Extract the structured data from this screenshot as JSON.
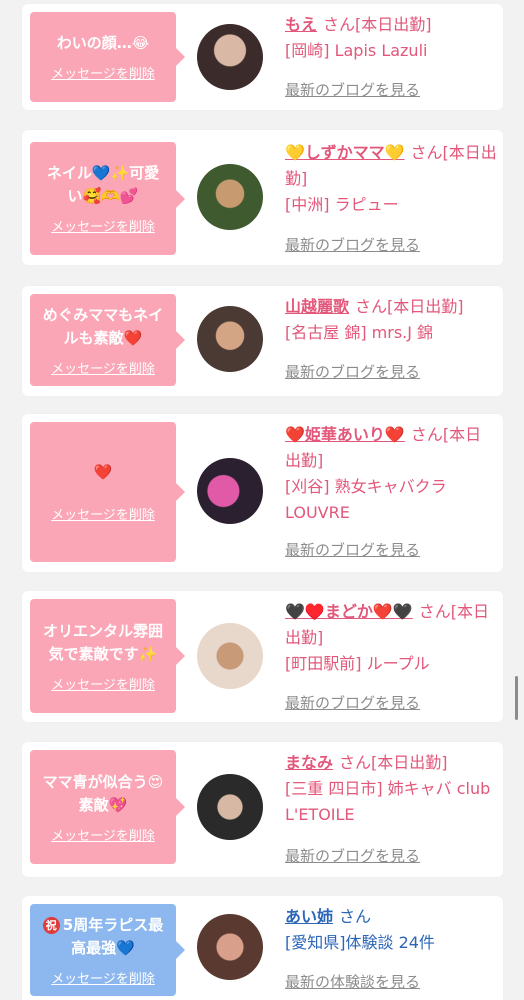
{
  "cards": [
    {
      "message": "わいの顔…😂",
      "delete_label": "メッセージを削除",
      "name": "もえ",
      "suffix": "さん[本日出勤]",
      "shop": "[岡崎] Lapis Lazuli",
      "link": "最新のブログを見る",
      "avatar_colors": [
        "#3b2b2a",
        "#d9b9a6"
      ]
    },
    {
      "message": "ネイル💙✨可愛い🥰🫶💕",
      "delete_label": "メッセージを削除",
      "name": "💛しずかママ💛",
      "suffix": "さん[本日出勤]",
      "shop": "[中洲] ラピュー",
      "link": "最新のブログを見る",
      "avatar_colors": [
        "#3f5a2e",
        "#c79a70"
      ]
    },
    {
      "message": "めぐみママもネイルも素敵❤️",
      "delete_label": "メッセージを削除",
      "name": "山越麗歌",
      "suffix": "さん[本日出勤]",
      "shop": "[名古屋 錦] mrs.J 錦",
      "link": "最新のブログを見る",
      "avatar_colors": [
        "#4a3a33",
        "#d4a585"
      ]
    },
    {
      "message": "❤️",
      "delete_label": "メッセージを削除",
      "name": "❤️姫華あいり❤️",
      "suffix": "さん[本日出勤]",
      "shop": "[刈谷] 熟女キャバクラ LOUVRE",
      "link": "最新のブログを見る",
      "avatar_colors": [
        "#2a2030",
        "#e05aa8"
      ]
    },
    {
      "message": "オリエンタル雰囲気で素敵です✨",
      "delete_label": "メッセージを削除",
      "name": "🖤♥️まどか❤️🖤",
      "suffix": "さん[本日出勤]",
      "shop": "[町田駅前] ループル",
      "link": "最新のブログを見る",
      "avatar_colors": [
        "#e8d8cc",
        "#c89a78"
      ]
    },
    {
      "message": "ママ青が似合う😍素敵💖",
      "delete_label": "メッセージを削除",
      "name": "まなみ",
      "suffix": "さん[本日出勤]",
      "shop": "[三重 四日市] 姉キャバ club L'ETOILE",
      "link": "最新のブログを見る",
      "avatar_colors": [
        "#2a2a2a",
        "#d6b8a4"
      ]
    },
    {
      "badge": "祝",
      "message": "5周年ラピス最高最強💙",
      "delete_label": "メッセージを削除",
      "name": "あい姉",
      "suffix": "さん",
      "shop": "[愛知県]体験談 24件",
      "link": "最新の体験談を見る",
      "avatar_colors": [
        "#5a3a30",
        "#d8a08a"
      ]
    }
  ],
  "colors": {
    "pink_bubble": "#fba6b6",
    "blue_bubble": "#8db8ef",
    "pink_text": "#e2577a",
    "blue_text": "#2c66b8",
    "grey_link": "#8c8c8c"
  }
}
